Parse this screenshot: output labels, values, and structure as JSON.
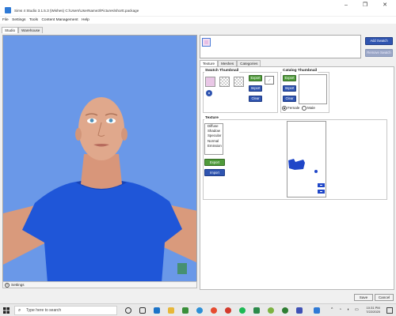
{
  "window": {
    "title": "Sims 4 Studio 3.1.5.3 (Wishes)  C:\\Users\\UserName3\\Pictures\\shortt.package",
    "minimize_label": "–",
    "maximize_label": "❐",
    "close_label": "✕"
  },
  "menu": {
    "items": [
      "File",
      "Settings",
      "Tools",
      "Content Management",
      "Help"
    ]
  },
  "top_tabs": [
    "Studio",
    "Warehouse"
  ],
  "viewport": {
    "settings_label": "Settings",
    "background_color": "#6a98e8",
    "shirt_color": "#1f56d8"
  },
  "swatch_buttons": {
    "add_swatch": "Add Swatch",
    "remove_swatch": "Remove Swatch"
  },
  "sub_tabs": [
    "Texture",
    "Meshes",
    "Categories"
  ],
  "swatch_thumbnail": {
    "title": "Swatch Thumbnail",
    "export": "Export",
    "import": "Import",
    "clear": "Clear"
  },
  "catalog_thumbnail": {
    "title": "Catalog Thumbnail",
    "export": "Export",
    "import": "Import",
    "clear": "Clear",
    "gender_options": [
      "Female",
      "Male"
    ],
    "gender_selected": "Female"
  },
  "texture": {
    "title": "Texture",
    "list": [
      "Diffuse",
      "Shadow",
      "Specular",
      "Normal",
      "Emission"
    ],
    "export": "Export",
    "import": "Import"
  },
  "footer": {
    "save": "Save",
    "cancel": "Cancel"
  },
  "taskbar": {
    "search_placeholder": "Type here to search",
    "time": "10:31 PM",
    "date": "7/22/2020"
  }
}
